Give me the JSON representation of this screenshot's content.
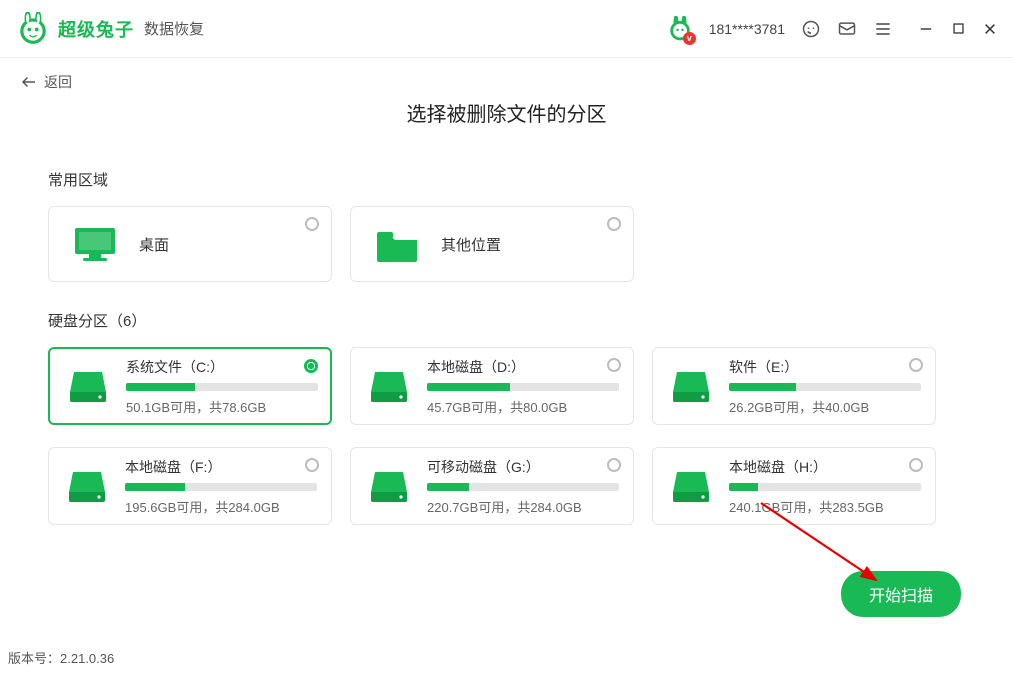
{
  "header": {
    "brand_main": "超级兔子",
    "brand_sub": "数据恢复",
    "user_phone": "181****3781",
    "v_badge": "v"
  },
  "nav": {
    "back_label": "返回"
  },
  "page": {
    "title": "选择被删除文件的分区"
  },
  "sections": {
    "common_heading": "常用区域",
    "disk_heading": "硬盘分区（6）"
  },
  "common_areas": [
    {
      "id": "desktop",
      "label": "桌面"
    },
    {
      "id": "other",
      "label": "其他位置"
    }
  ],
  "disks": [
    {
      "id": "c",
      "name": "系统文件（C:）",
      "sub": "50.1GB可用，共78.6GB",
      "fill": 36,
      "selected": true
    },
    {
      "id": "d",
      "name": "本地磁盘（D:）",
      "sub": "45.7GB可用，共80.0GB",
      "fill": 43,
      "selected": false
    },
    {
      "id": "e",
      "name": "软件（E:）",
      "sub": "26.2GB可用，共40.0GB",
      "fill": 35,
      "selected": false
    },
    {
      "id": "f",
      "name": "本地磁盘（F:）",
      "sub": "195.6GB可用，共284.0GB",
      "fill": 31,
      "selected": false
    },
    {
      "id": "g",
      "name": "可移动磁盘（G:）",
      "sub": "220.7GB可用，共284.0GB",
      "fill": 22,
      "selected": false
    },
    {
      "id": "h",
      "name": "本地磁盘（H:）",
      "sub": "240.1GB可用，共283.5GB",
      "fill": 15,
      "selected": false
    }
  ],
  "actions": {
    "scan_label": "开始扫描"
  },
  "footer": {
    "version_prefix": "版本号：",
    "version_value": "2.21.0.36"
  },
  "colors": {
    "accent": "#19b955"
  }
}
